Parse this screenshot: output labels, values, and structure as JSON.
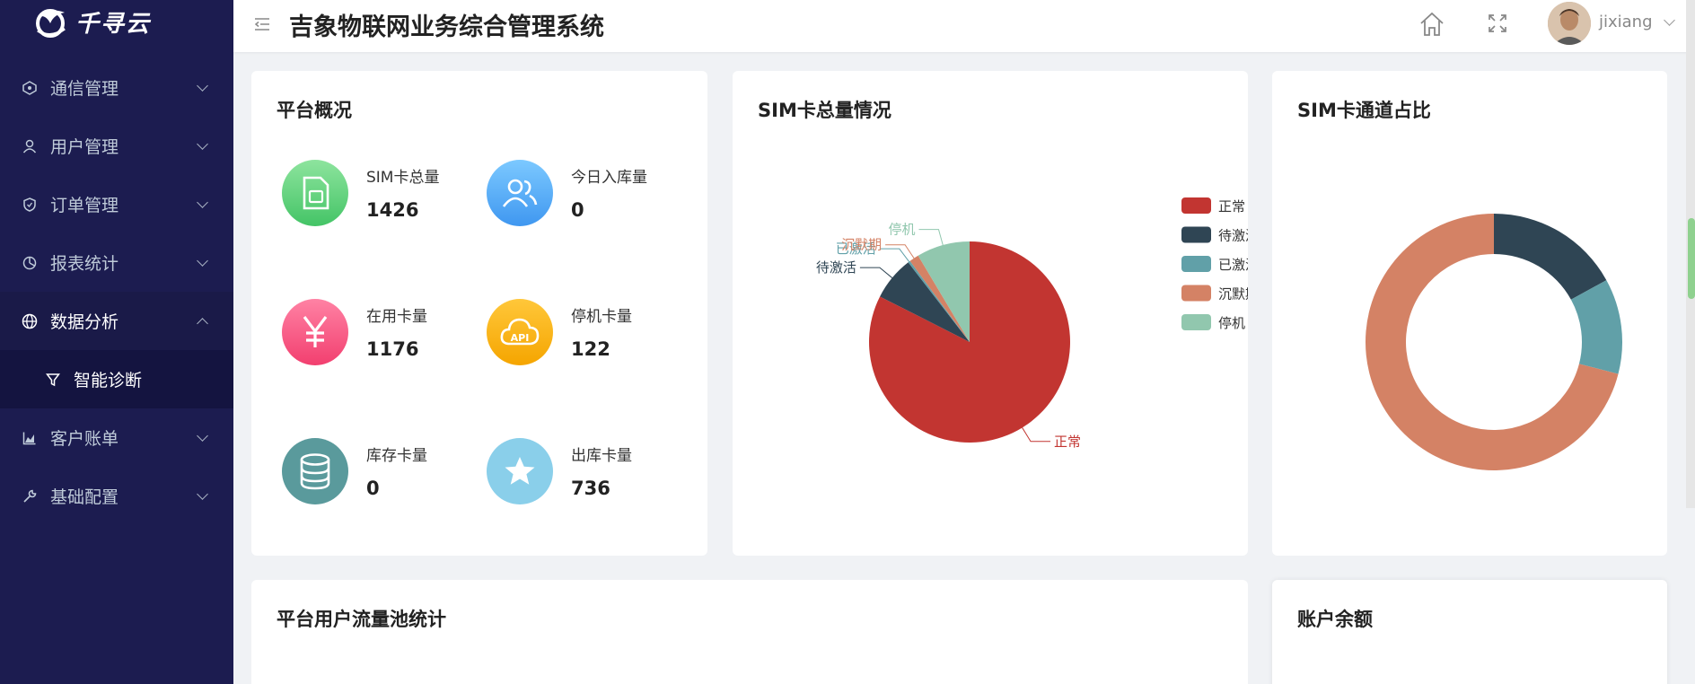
{
  "brand": {
    "name": "千寻云"
  },
  "header": {
    "title": "吉象物联网业务综合管理系统",
    "username": "jixiang"
  },
  "sidebar": {
    "items": [
      {
        "label": "通信管理",
        "icon": "network-icon"
      },
      {
        "label": "用户管理",
        "icon": "user-icon"
      },
      {
        "label": "订单管理",
        "icon": "shield-icon"
      },
      {
        "label": "报表统计",
        "icon": "pie-chart-icon"
      },
      {
        "label": "数据分析",
        "icon": "globe-icon",
        "expanded": true
      },
      {
        "label": "客户账单",
        "icon": "area-chart-icon"
      },
      {
        "label": "基础配置",
        "icon": "wrench-icon"
      }
    ],
    "submenu": [
      {
        "label": "智能诊断",
        "icon": "filter-icon"
      }
    ]
  },
  "overview": {
    "title": "平台概况",
    "stats": [
      {
        "label": "SIM卡总量",
        "value": "1426",
        "icon": "sim-card-icon",
        "color": "#5dd17a"
      },
      {
        "label": "今日入库量",
        "value": "0",
        "icon": "users-icon",
        "color": "#4ea8f5"
      },
      {
        "label": "在用卡量",
        "value": "1176",
        "icon": "yen-icon",
        "color": "#f7507e"
      },
      {
        "label": "停机卡量",
        "value": "122",
        "icon": "cloud-api-icon",
        "color": "#f5b016"
      },
      {
        "label": "库存卡量",
        "value": "0",
        "icon": "database-icon",
        "color": "#5a9a9c"
      },
      {
        "label": "出库卡量",
        "value": "736",
        "icon": "star-icon",
        "color": "#82cbe8"
      }
    ]
  },
  "sim_chart": {
    "title": "SIM卡总量情况"
  },
  "channel_chart": {
    "title": "SIM卡通道占比"
  },
  "pool": {
    "title": "平台用户流量池统计"
  },
  "balance": {
    "title": "账户余额"
  },
  "colors": {
    "sidebar_bg": "#1c1c50",
    "normal": "#c23531",
    "to_activate": "#2f4554",
    "activated": "#61a0a8",
    "silent": "#d48265",
    "stopped": "#91c7ae"
  },
  "chart_data": [
    {
      "type": "pie",
      "title": "SIM卡总量情况",
      "legend": [
        "正常",
        "待激活",
        "已激活",
        "沉默期",
        "停机"
      ],
      "legend_position": "right",
      "slices": [
        {
          "name": "正常",
          "value": 1176,
          "color": "#c23531"
        },
        {
          "name": "待激活",
          "value": 101,
          "color": "#2f4554"
        },
        {
          "name": "已激活",
          "value": 5,
          "color": "#61a0a8"
        },
        {
          "name": "沉默期",
          "value": 22,
          "color": "#d48265"
        },
        {
          "name": "停机",
          "value": 122,
          "color": "#91c7ae"
        }
      ]
    },
    {
      "type": "pie",
      "subtype": "donut",
      "title": "SIM卡通道占比",
      "slices": [
        {
          "value": 17,
          "color": "#2f4554"
        },
        {
          "value": 12,
          "color": "#61a0a8"
        },
        {
          "value": 71,
          "color": "#d48265"
        }
      ]
    }
  ]
}
